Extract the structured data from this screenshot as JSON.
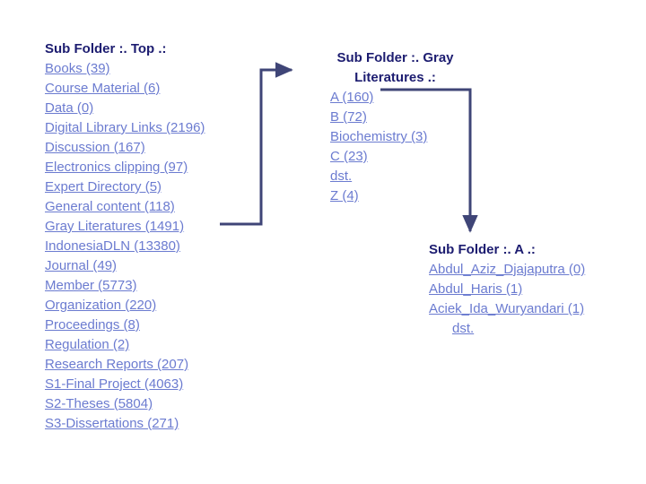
{
  "page": {
    "background_color": "#ffffff",
    "heading_color": "#1c1c70",
    "link_color": "#6b7bd0",
    "connector_color": "#3f4577"
  },
  "panels": {
    "top": {
      "heading": "Sub Folder :. Top .:",
      "items": [
        "Books (39)",
        "Course Material (6)",
        "Data (0)",
        "Digital Library Links (2196)",
        "Discussion (167)",
        "Electronics clipping (97)",
        "Expert Directory (5)",
        "General content (118)",
        "Gray Literatures (1491)",
        "IndonesiaDLN (13380)",
        "Journal (49)",
        "Member (5773)",
        "Organization (220)",
        "Proceedings (8)",
        "Regulation (2)",
        "Research Reports (207)",
        "S1-Final Project (4063)",
        "S2-Theses (5804)",
        "S3-Dissertations (271)"
      ]
    },
    "gray_literatures": {
      "heading": "Sub Folder :. Gray Literatures .:",
      "items": [
        "A (160)",
        "B (72)",
        "Biochemistry (3)",
        "C (23)",
        "dst.",
        "Z (4)"
      ]
    },
    "folder_a": {
      "heading": "Sub Folder :. A .:",
      "items": [
        "Abdul_Aziz_Djajaputra (0)",
        "Abdul_Haris (1)",
        "Aciek_Ida_Wuryandari (1)",
        "dst."
      ]
    }
  },
  "connectors": [
    {
      "name": "gray-literatures-to-gray-panel",
      "from_label": "Gray Literatures (1491)",
      "to_label": "Sub Folder :. Gray Literatures .:"
    },
    {
      "name": "a-to-folder-a-panel",
      "from_label": "A (160)",
      "to_label": "Sub Folder :. A .:"
    }
  ]
}
